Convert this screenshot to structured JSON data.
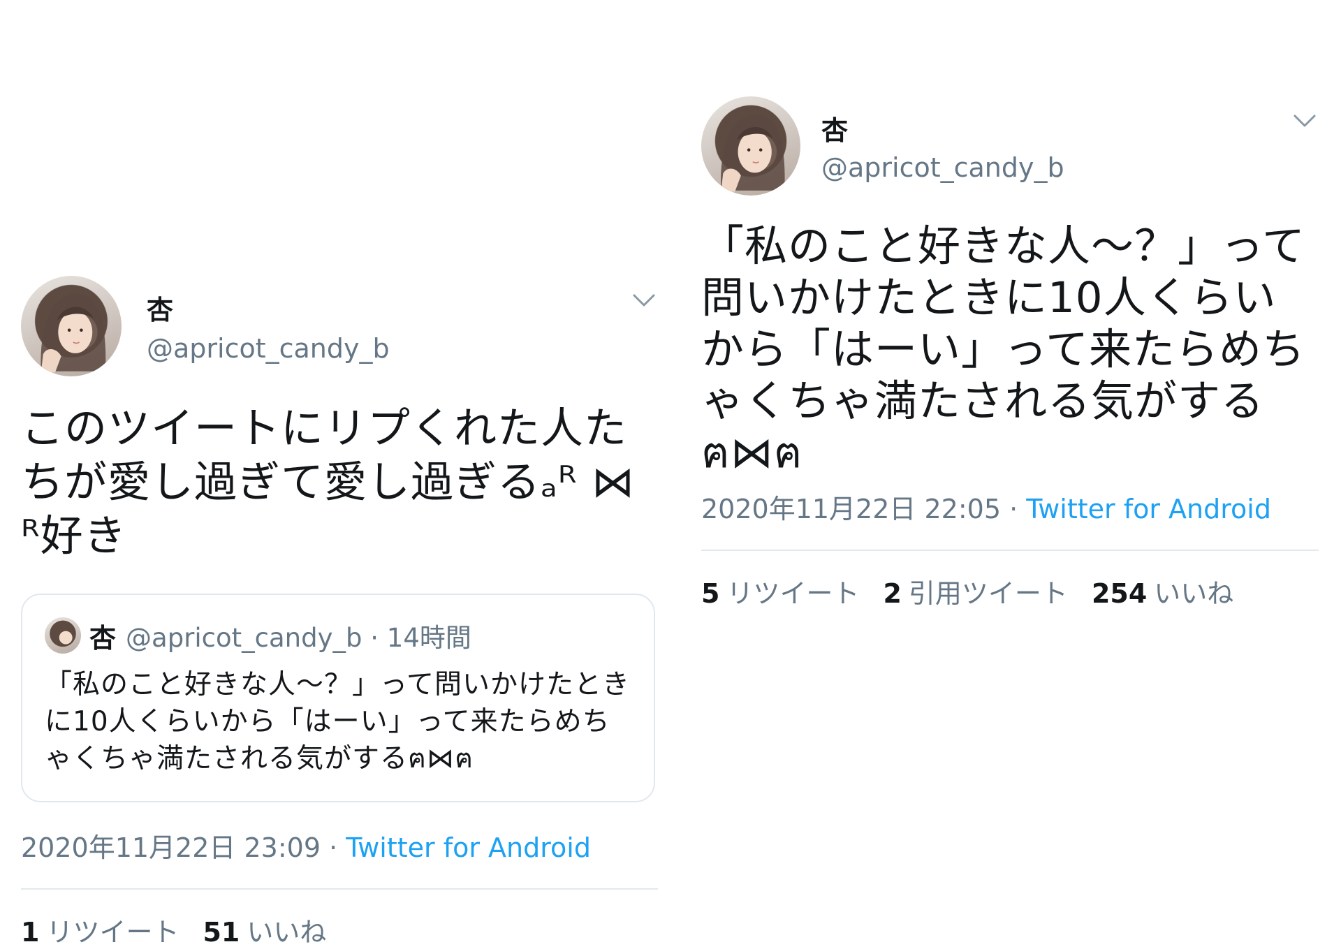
{
  "left_tweet": {
    "name": "杏",
    "handle": "@apricot_candy_b",
    "text": "このツイートにリプくれた人たちが愛し過ぎて愛し過ぎるₐᴿ ⋈ ᴿ好き",
    "quote": {
      "name": "杏",
      "meta": "@apricot_candy_b · 14時間",
      "text": "「私のこと好きな人〜？」って問いかけたときに10人くらいから「はーい」って来たらめちゃくちゃ満たされる気がするฅ⋈ฅ"
    },
    "date": "2020年11月22日 23:09",
    "separator": " · ",
    "source": "Twitter for Android",
    "stats": [
      {
        "num": "1",
        "label": "リツイート"
      },
      {
        "num": "51",
        "label": "いいね"
      }
    ]
  },
  "right_tweet": {
    "name": "杏",
    "handle": "@apricot_candy_b",
    "text": "「私のこと好きな人〜？」って問いかけたときに10人くらいから「はーい」って来たらめちゃくちゃ満たされる気がするฅ⋈ฅ",
    "date": "2020年11月22日 22:05",
    "separator": " · ",
    "source": "Twitter for Android",
    "stats": [
      {
        "num": "5",
        "label": "リツイート"
      },
      {
        "num": "2",
        "label": "引用ツイート"
      },
      {
        "num": "254",
        "label": "いいね"
      }
    ]
  },
  "icons": {
    "menu": "chevron-down-icon"
  },
  "colors": {
    "accent": "#1da1f2",
    "secondary_text": "#657786",
    "divider": "#e1e8ed"
  }
}
